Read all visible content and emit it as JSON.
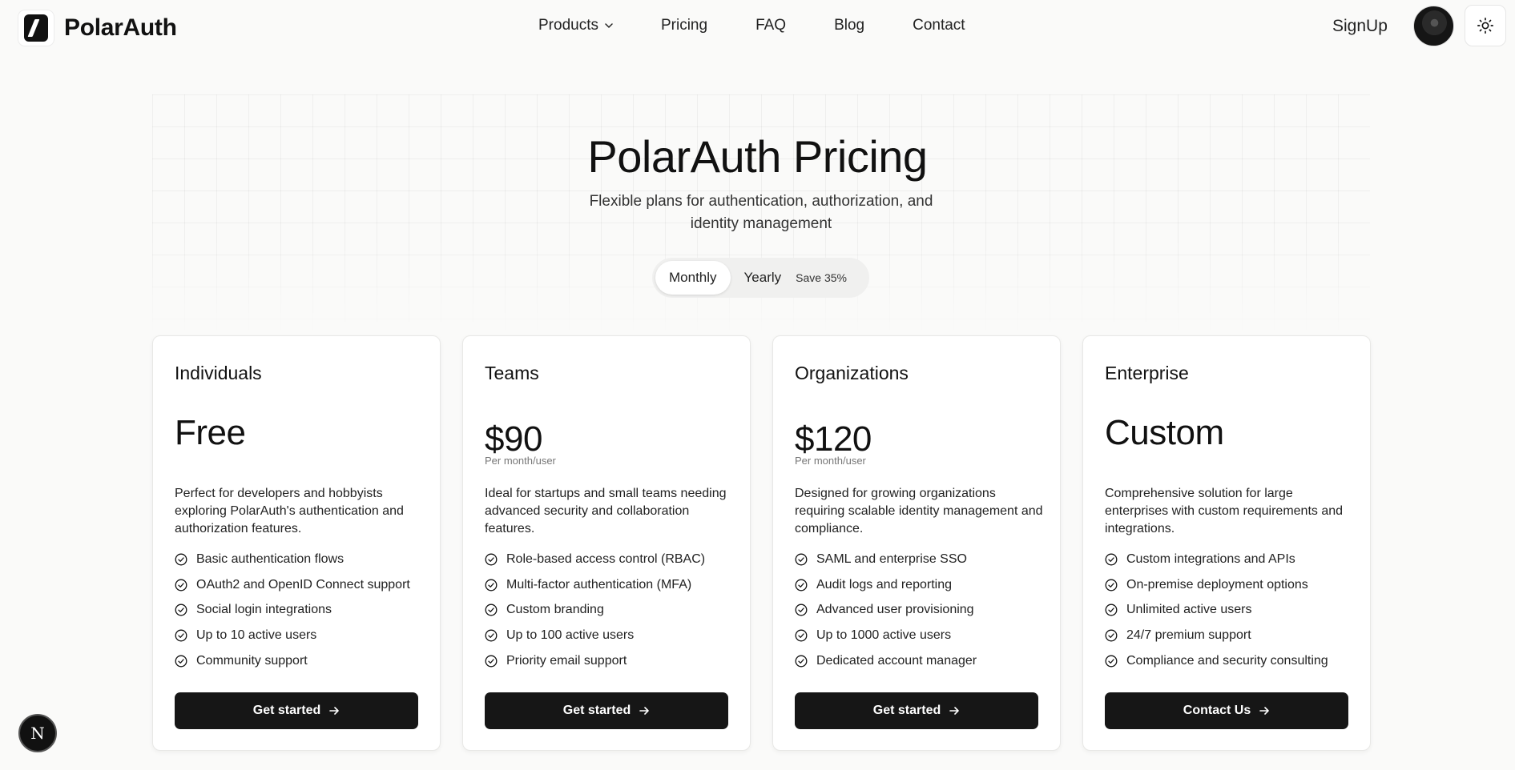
{
  "brand": {
    "name": "PolarAuth"
  },
  "nav": {
    "items": [
      {
        "label": "Products",
        "has_dropdown": true
      },
      {
        "label": "Pricing"
      },
      {
        "label": "FAQ"
      },
      {
        "label": "Blog"
      },
      {
        "label": "Contact"
      }
    ],
    "signup_label": "SignUp"
  },
  "hero": {
    "title": "PolarAuth Pricing",
    "subtitle": "Flexible plans for authentication, authorization, and identity management"
  },
  "billing_toggle": {
    "options": [
      "Monthly",
      "Yearly"
    ],
    "selected": "Monthly",
    "badge": "Save 35%"
  },
  "plans": [
    {
      "name": "Individuals",
      "price": "Free",
      "per": "",
      "description": "Perfect for developers and hobbyists exploring PolarAuth's authentication and authorization features.",
      "features": [
        "Basic authentication flows",
        "OAuth2 and OpenID Connect support",
        "Social login integrations",
        "Up to 10 active users",
        "Community support"
      ],
      "cta": "Get started"
    },
    {
      "name": "Teams",
      "price": "$90",
      "per": "Per month/user",
      "description": "Ideal for startups and small teams needing advanced security and collaboration features.",
      "features": [
        "Role-based access control (RBAC)",
        "Multi-factor authentication (MFA)",
        "Custom branding",
        "Up to 100 active users",
        "Priority email support"
      ],
      "cta": "Get started"
    },
    {
      "name": "Organizations",
      "price": "$120",
      "per": "Per month/user",
      "description": "Designed for growing organizations requiring scalable identity management and compliance.",
      "features": [
        "SAML and enterprise SSO",
        "Audit logs and reporting",
        "Advanced user provisioning",
        "Up to 1000 active users",
        "Dedicated account manager"
      ],
      "cta": "Get started"
    },
    {
      "name": "Enterprise",
      "price": "Custom",
      "per": "",
      "description": "Comprehensive solution for large enterprises with custom requirements and integrations.",
      "features": [
        "Custom integrations and APIs",
        "On-premise deployment options",
        "Unlimited active users",
        "24/7 premium support",
        "Compliance and security consulting"
      ],
      "cta": "Contact Us"
    }
  ],
  "dev_badge": {
    "label": "N"
  },
  "icons": [
    "chevron-down-icon",
    "sun-icon",
    "check-circle-icon",
    "arrow-right-icon"
  ]
}
